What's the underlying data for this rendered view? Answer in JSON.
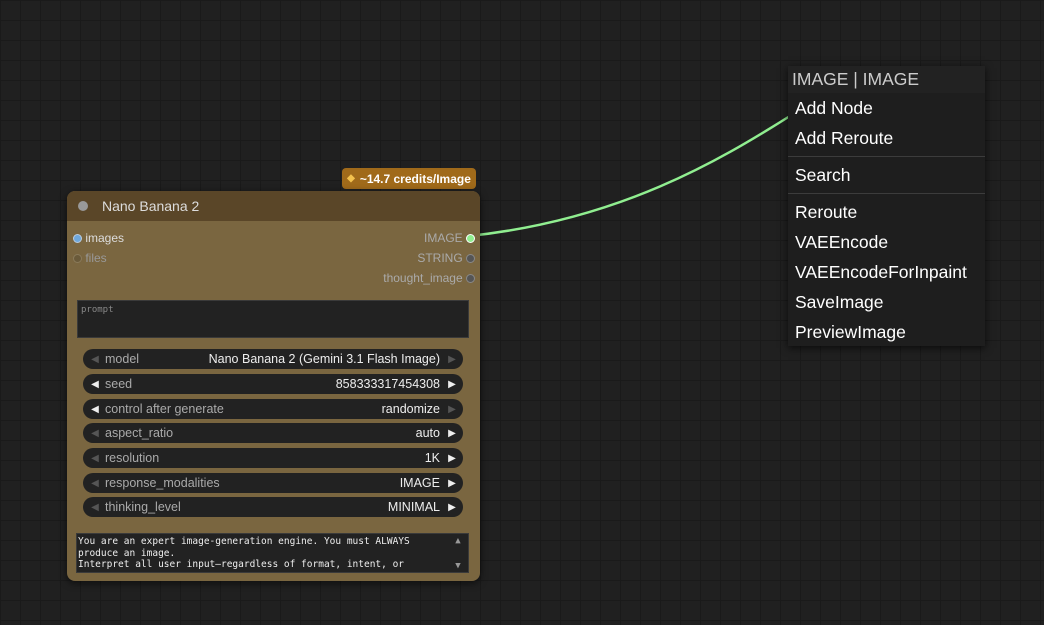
{
  "badge": {
    "text": "~14.7 credits/Image"
  },
  "node": {
    "title": "Nano Banana 2",
    "inputs": [
      {
        "label": "images"
      },
      {
        "label": "files"
      }
    ],
    "outputs": [
      {
        "label": "IMAGE"
      },
      {
        "label": "STRING"
      },
      {
        "label": "thought_image"
      }
    ],
    "prompt_placeholder": "prompt",
    "widgets": [
      {
        "label": "model",
        "value": "Nano Banana 2 (Gemini 3.1 Flash Image)"
      },
      {
        "label": "seed",
        "value": "858333317454308"
      },
      {
        "label": "control after generate",
        "value": "randomize"
      },
      {
        "label": "aspect_ratio",
        "value": "auto"
      },
      {
        "label": "resolution",
        "value": "1K"
      },
      {
        "label": "response_modalities",
        "value": "IMAGE"
      },
      {
        "label": "thinking_level",
        "value": "MINIMAL"
      }
    ],
    "system_prompt": "You are an expert image-generation engine. You must ALWAYS produce an image.\nInterpret all user input—regardless of format, intent, or"
  },
  "menu": {
    "title": "IMAGE | IMAGE",
    "items": [
      "Add Node",
      "Add Reroute",
      "Search",
      "Reroute",
      "VAEEncode",
      "VAEEncodeForInpaint",
      "SaveImage",
      "PreviewImage"
    ]
  },
  "colors": {
    "link": "#90ee90",
    "node_body": "#7a6640",
    "node_header": "#5a4628",
    "badge": "#a06a1a",
    "input_slot": "#6fa8dc"
  }
}
